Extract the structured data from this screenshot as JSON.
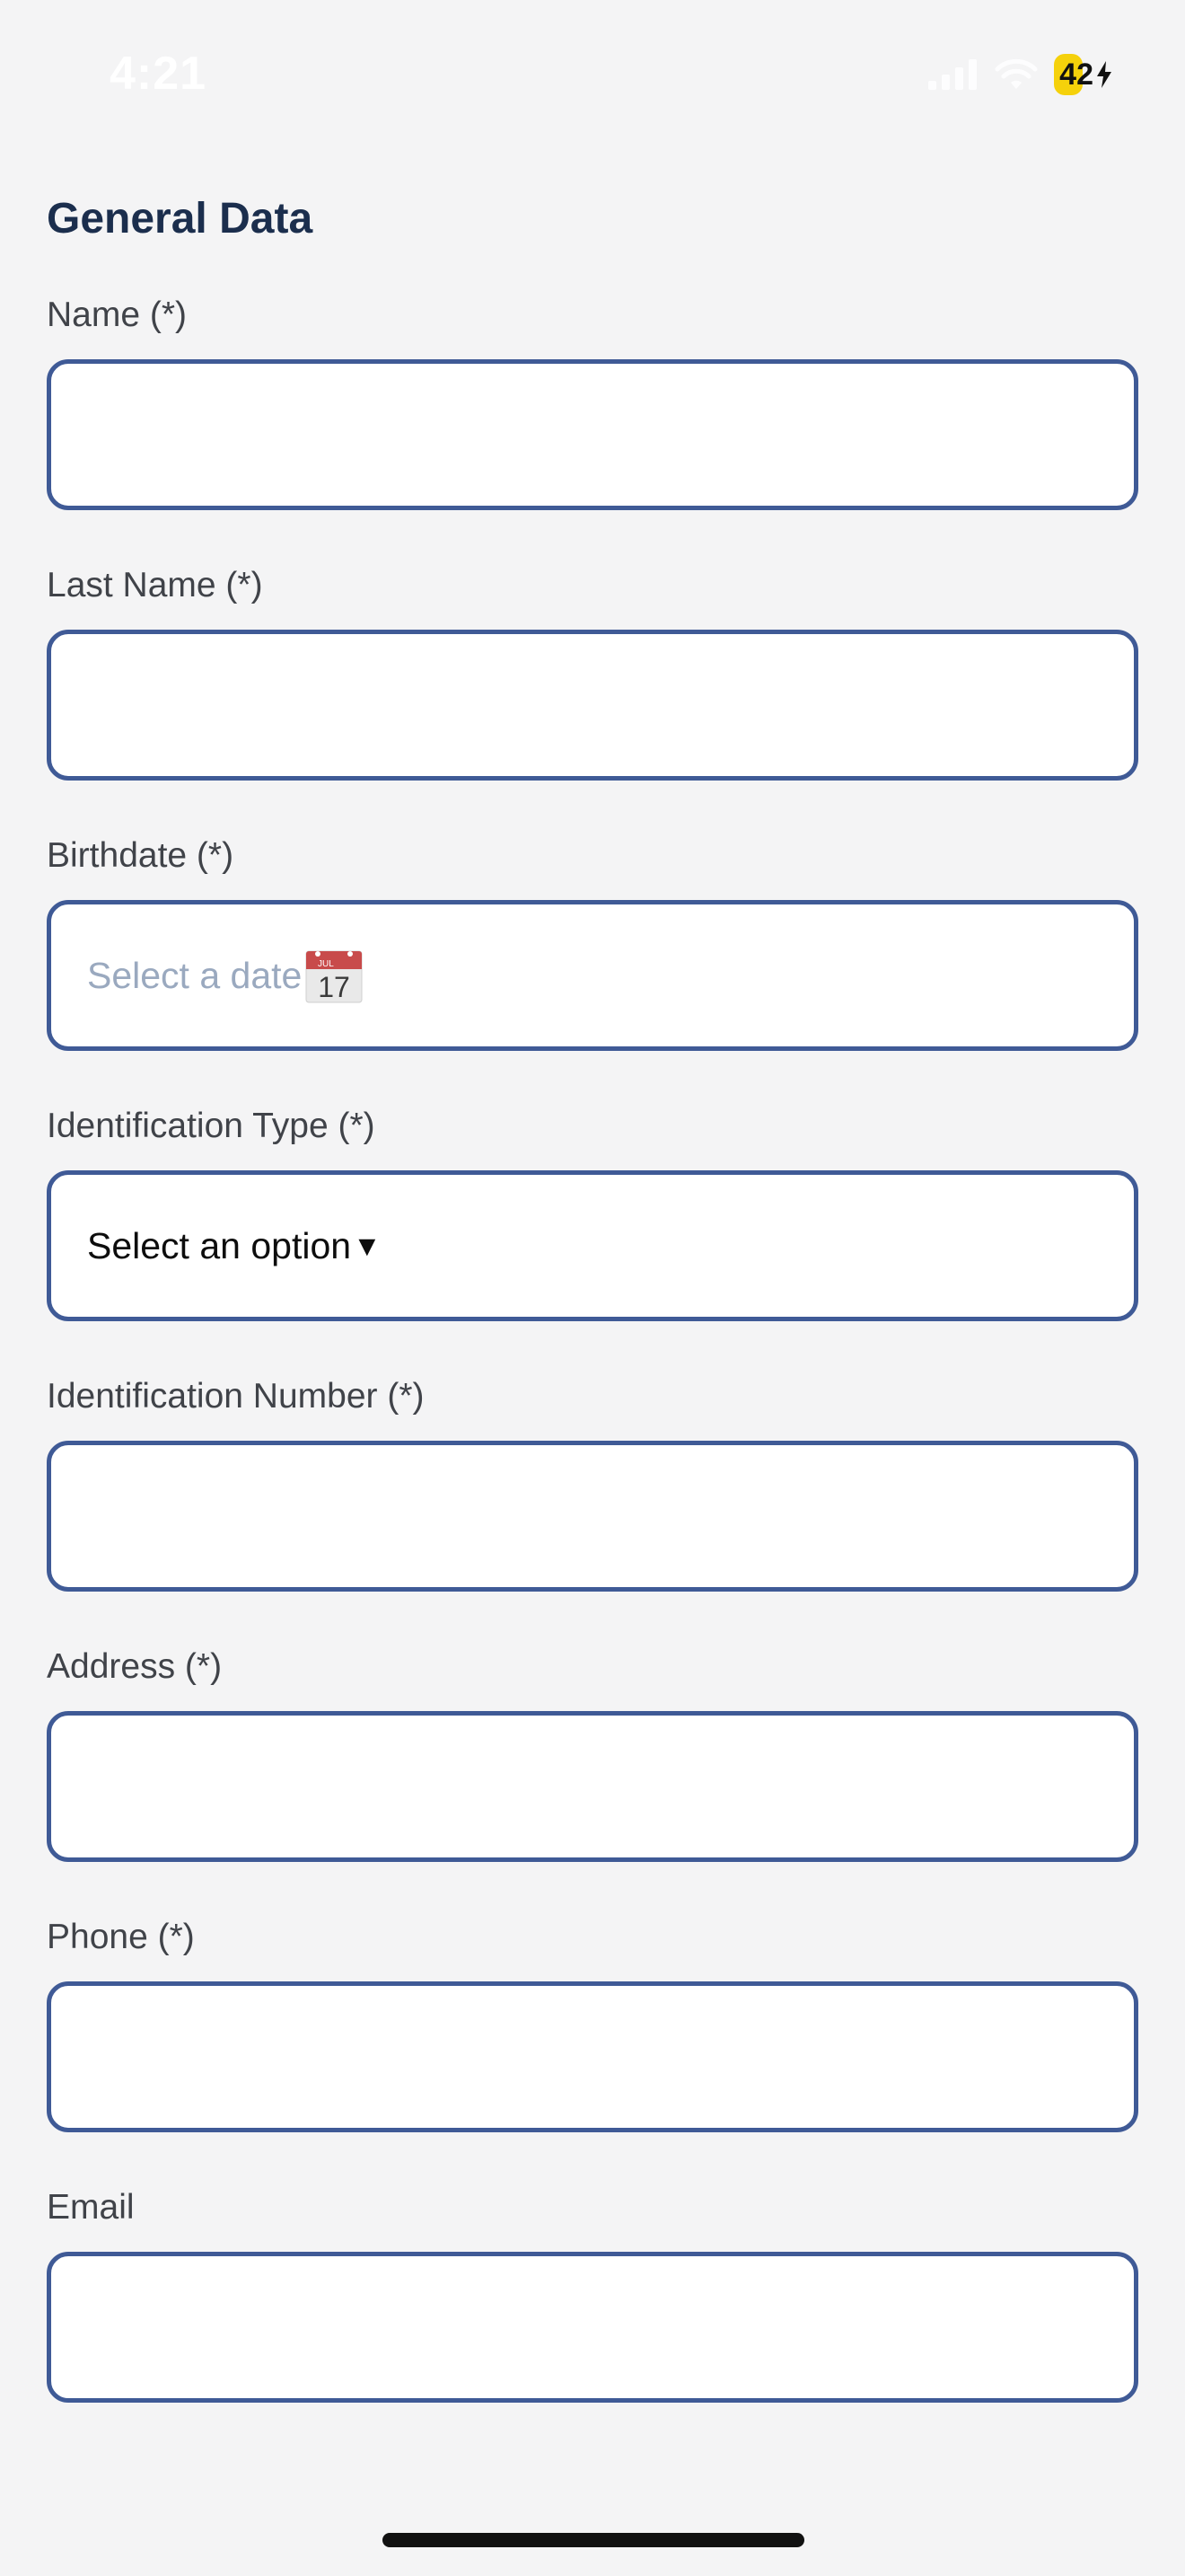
{
  "status_bar": {
    "time": "4:21",
    "battery_level": "42",
    "battery_fill_fraction": 0.42,
    "icons": [
      "signal-icon",
      "wifi-icon",
      "battery-icon",
      "charging-bolt-icon"
    ]
  },
  "form": {
    "section_title": "General Data",
    "fields": {
      "name": {
        "label": "Name (*)",
        "value": ""
      },
      "last_name": {
        "label": "Last Name (*)",
        "value": ""
      },
      "birthdate": {
        "label": "Birthdate (*)",
        "placeholder": "Select a date",
        "icon": "calendar-icon",
        "icon_month": "JUL",
        "icon_day": "17"
      },
      "id_type": {
        "label": "Identification Type (*)",
        "selected": "Select an option",
        "caret": "▼"
      },
      "id_number": {
        "label": "Identification Number (*)",
        "value": ""
      },
      "address": {
        "label": "Address (*)",
        "value": ""
      },
      "phone": {
        "label": "Phone (*)",
        "value": ""
      },
      "email": {
        "label": "Email",
        "value": ""
      }
    }
  },
  "colors": {
    "background": "#f4f4f5",
    "title": "#1b2e4d",
    "input_border": "#3f5a96",
    "placeholder": "#9aa9bf",
    "battery": "#f5d10b"
  }
}
